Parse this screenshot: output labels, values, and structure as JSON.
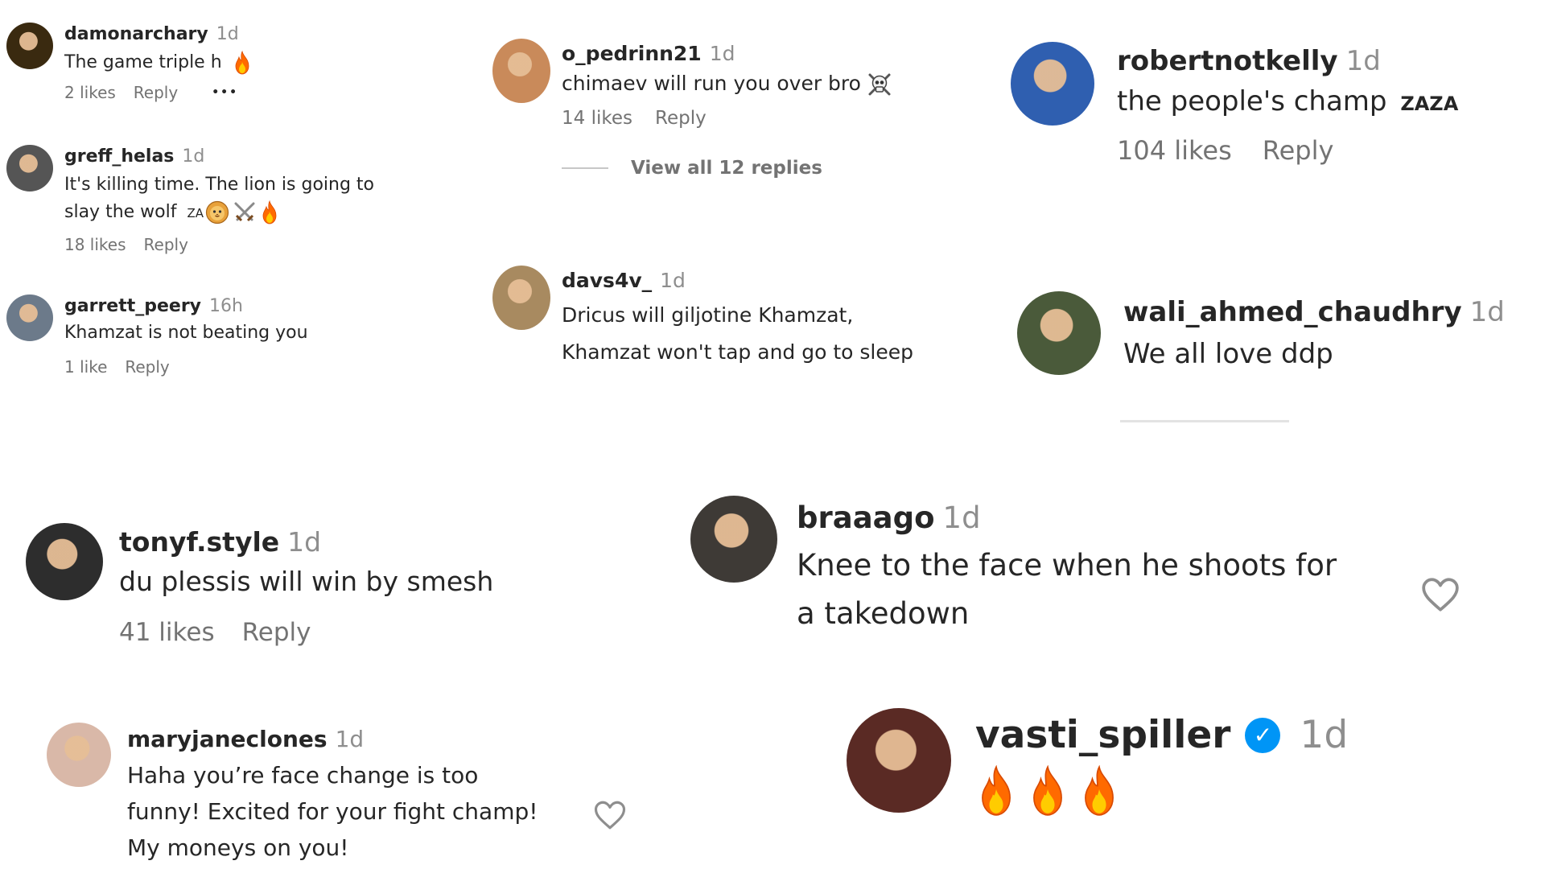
{
  "colors": {
    "username": "#262626",
    "muted": "#8e8e8e",
    "verified": "#0095f6",
    "fire_outer": "#ff6a00",
    "fire_inner": "#ffcc00"
  },
  "comments": [
    {
      "username": "damonarchary",
      "time": "1d",
      "text": "The game triple h",
      "text_emojis": [
        "fire-emoji"
      ],
      "likes": "2 likes",
      "reply": "Reply",
      "more": "•••"
    },
    {
      "username": "greff_helas",
      "time": "1d",
      "text_line1": "It's killing time. The lion is going to",
      "text_line2": "slay the wolf",
      "text_tag": "ZA",
      "text_emojis": [
        "lion-emoji",
        "crossed-swords-emoji",
        "fire-emoji"
      ],
      "likes": "18 likes",
      "reply": "Reply"
    },
    {
      "username": "garrett_peery",
      "time": "16h",
      "text": "Khamzat is not beating you",
      "likes": "1 like",
      "reply": "Reply"
    },
    {
      "username": "o_pedrinn21",
      "time": "1d",
      "text": "chimaev will run you over bro",
      "text_emojis": [
        "skull-crossbones-emoji"
      ],
      "likes": "14 likes",
      "reply": "Reply",
      "view_replies": "View all 12 replies"
    },
    {
      "username": "davs4v_",
      "time": "1d",
      "text_line1": "Dricus will giljotine Khamzat,",
      "text_line2": "Khamzat won't tap and go to sleep"
    },
    {
      "username": "robertnotkelly",
      "time": "1d",
      "text": "the people's champ",
      "text_tag": "ZAZA",
      "likes": "104 likes",
      "reply": "Reply"
    },
    {
      "username": "wali_ahmed_chaudhry",
      "time": "1d",
      "text": "We all love ddp"
    },
    {
      "username": "tonyf.style",
      "time": "1d",
      "text": "du plessis will win by smesh",
      "likes": "41 likes",
      "reply": "Reply"
    },
    {
      "username": "braaago",
      "time": "1d",
      "text_line1": "Knee to the face when he shoots for",
      "text_line2": "a takedown"
    },
    {
      "username": "maryjaneclones",
      "time": "1d",
      "text_line1": "Haha you’re face change is too",
      "text_line2": "funny! Excited for your fight champ!",
      "text_line3": "My moneys on you!"
    },
    {
      "username": "vasti_spiller",
      "time": "1d",
      "verified": true,
      "text_emojis": [
        "fire-emoji",
        "fire-emoji",
        "fire-emoji"
      ]
    }
  ]
}
